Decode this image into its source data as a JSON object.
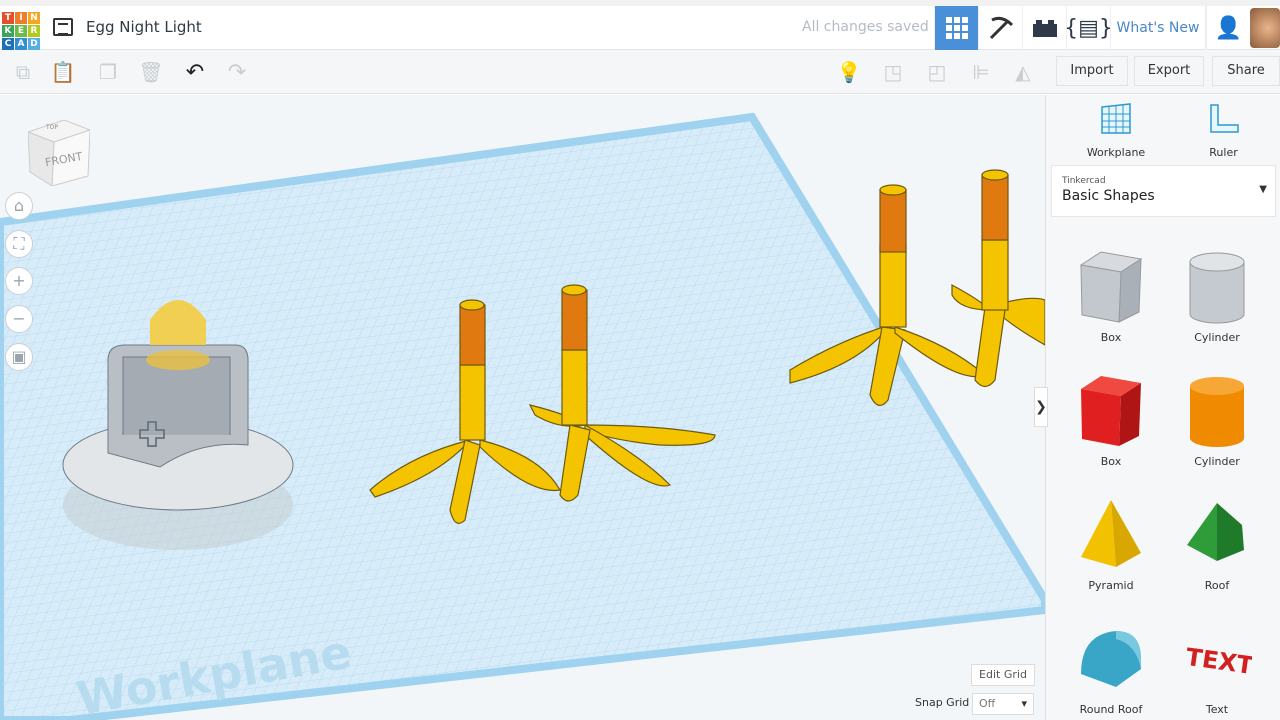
{
  "header": {
    "logo": [
      "T",
      "I",
      "N",
      "K",
      "E",
      "R",
      "C",
      "A",
      "D"
    ],
    "title": "Egg Night Light",
    "status": "All changes saved",
    "whats_new": "What's New"
  },
  "toolbar": {
    "import": "Import",
    "export": "Export",
    "share": "Share"
  },
  "panel": {
    "workplane": "Workplane",
    "ruler": "Ruler",
    "library_source": "Tinkercad",
    "library": "Basic Shapes",
    "shapes": [
      {
        "label": "Box",
        "color": "#b8bec6"
      },
      {
        "label": "Cylinder",
        "color": "#c5cad0"
      },
      {
        "label": "Box",
        "color": "#e02020"
      },
      {
        "label": "Cylinder",
        "color": "#f08a00"
      },
      {
        "label": "Pyramid",
        "color": "#f2c200"
      },
      {
        "label": "Roof",
        "color": "#2f9c3a"
      },
      {
        "label": "Round Roof",
        "color": "#39a6c8"
      },
      {
        "label": "Text",
        "color": "#d21f1f"
      }
    ]
  },
  "viewport": {
    "cube_top": "TOP",
    "cube_front": "FRONT",
    "workplane_label": "Workplane",
    "edit_grid": "Edit Grid",
    "snap_grid_label": "Snap Grid",
    "snap_grid_value": "Off"
  },
  "colors": {
    "accent": "#4a90d9",
    "workplane": "#cfe8f7"
  }
}
